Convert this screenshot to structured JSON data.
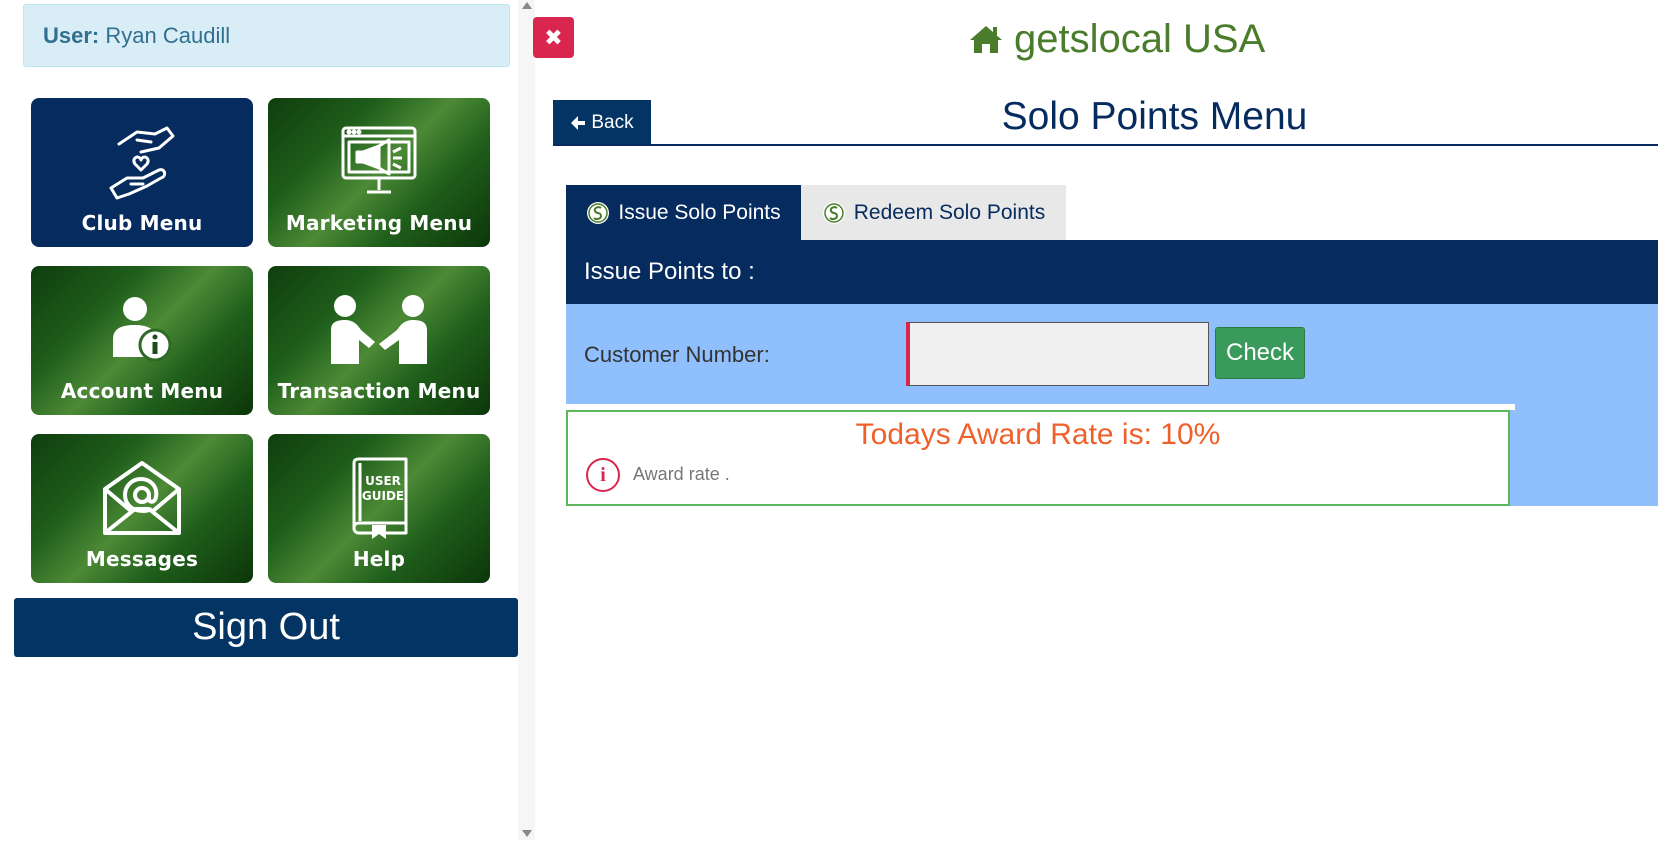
{
  "user": {
    "label": "User:",
    "name": "Ryan Caudill"
  },
  "sidebar": {
    "tiles": [
      {
        "label": "Club Menu",
        "icon": "hands-heart-icon"
      },
      {
        "label": "Marketing Menu",
        "icon": "monitor-megaphone-icon"
      },
      {
        "label": "Account Menu",
        "icon": "user-info-icon"
      },
      {
        "label": "Transaction Menu",
        "icon": "handshake-icon"
      },
      {
        "label": "Messages",
        "icon": "envelope-at-icon"
      },
      {
        "label": "Help",
        "icon": "user-guide-book-icon"
      }
    ],
    "user_guide_text": [
      "USER",
      "GUIDE"
    ],
    "sign_out": "Sign Out"
  },
  "header": {
    "brand": "getslocal USA",
    "back": "Back",
    "title": "Solo Points Menu"
  },
  "tabs": [
    {
      "label": "Issue Solo Points",
      "active": true
    },
    {
      "label": "Redeem Solo Points",
      "active": false
    }
  ],
  "issue": {
    "heading": "Issue Points to :",
    "customer_label": "Customer Number:",
    "customer_value": "",
    "check": "Check",
    "award_rate_text": "Todays Award Rate is:  10%",
    "award_note": "Award rate ."
  },
  "colors": {
    "navy": "#062b5e",
    "green_tile": "#1f5e1b",
    "brand_green": "#4a7c2b",
    "close_red": "#d9264f",
    "form_blue": "#8fbffc",
    "check_green": "#3a9a5b",
    "rate_orange": "#f0602b"
  }
}
